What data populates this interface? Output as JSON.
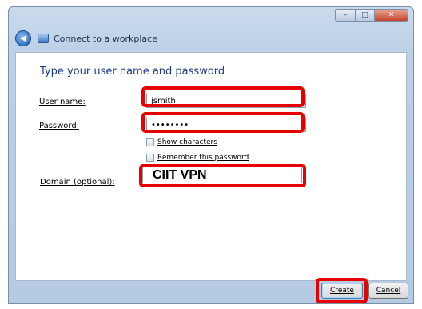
{
  "window": {
    "title": "Connect to a workplace",
    "controls": {
      "minimize": "–",
      "maximize": "□",
      "close": "✕"
    }
  },
  "form": {
    "heading": "Type your user name and password",
    "username": {
      "label": "User name:",
      "value": "jsmith"
    },
    "password": {
      "label": "Password:",
      "value": "••••••••"
    },
    "show_characters": "Show characters",
    "remember_password": "Remember this password",
    "domain": {
      "label": "Domain (optional):",
      "value": "CIIT VPN"
    }
  },
  "buttons": {
    "create": "Create",
    "cancel": "Cancel"
  },
  "colors": {
    "highlight": "#e60000",
    "heading": "#1e3a8a"
  }
}
